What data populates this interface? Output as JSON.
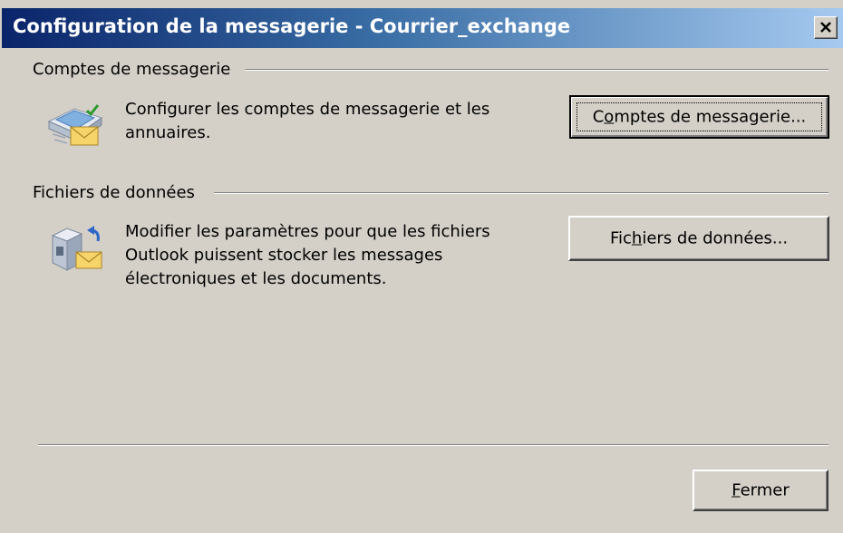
{
  "window": {
    "title": "Configuration de la messagerie - Courrier_exchange",
    "close_label": "Fermer la fenêtre"
  },
  "accounts": {
    "group_label": "Comptes de messagerie",
    "description_line1": "Configurer les comptes de messagerie et les",
    "description_line2": "annuaires.",
    "button": {
      "before": "C",
      "mnemonic": "o",
      "after": "mptes de messagerie..."
    },
    "icon": "mail-accounts-icon"
  },
  "data_files": {
    "group_label": "Fichiers de données",
    "description_line1": "Modifier les paramètres pour que les fichiers",
    "description_line2": "Outlook puissent stocker les messages",
    "description_line3": "électroniques et les documents.",
    "button": {
      "before": "Fic",
      "mnemonic": "h",
      "after": "iers de données..."
    },
    "icon": "data-files-icon"
  },
  "footer": {
    "close_button": {
      "mnemonic": "F",
      "after": "ermer"
    }
  },
  "colors": {
    "dialog_bg": "#d4d0c8",
    "title_start": "#0a246a",
    "title_end": "#a6caf0"
  }
}
